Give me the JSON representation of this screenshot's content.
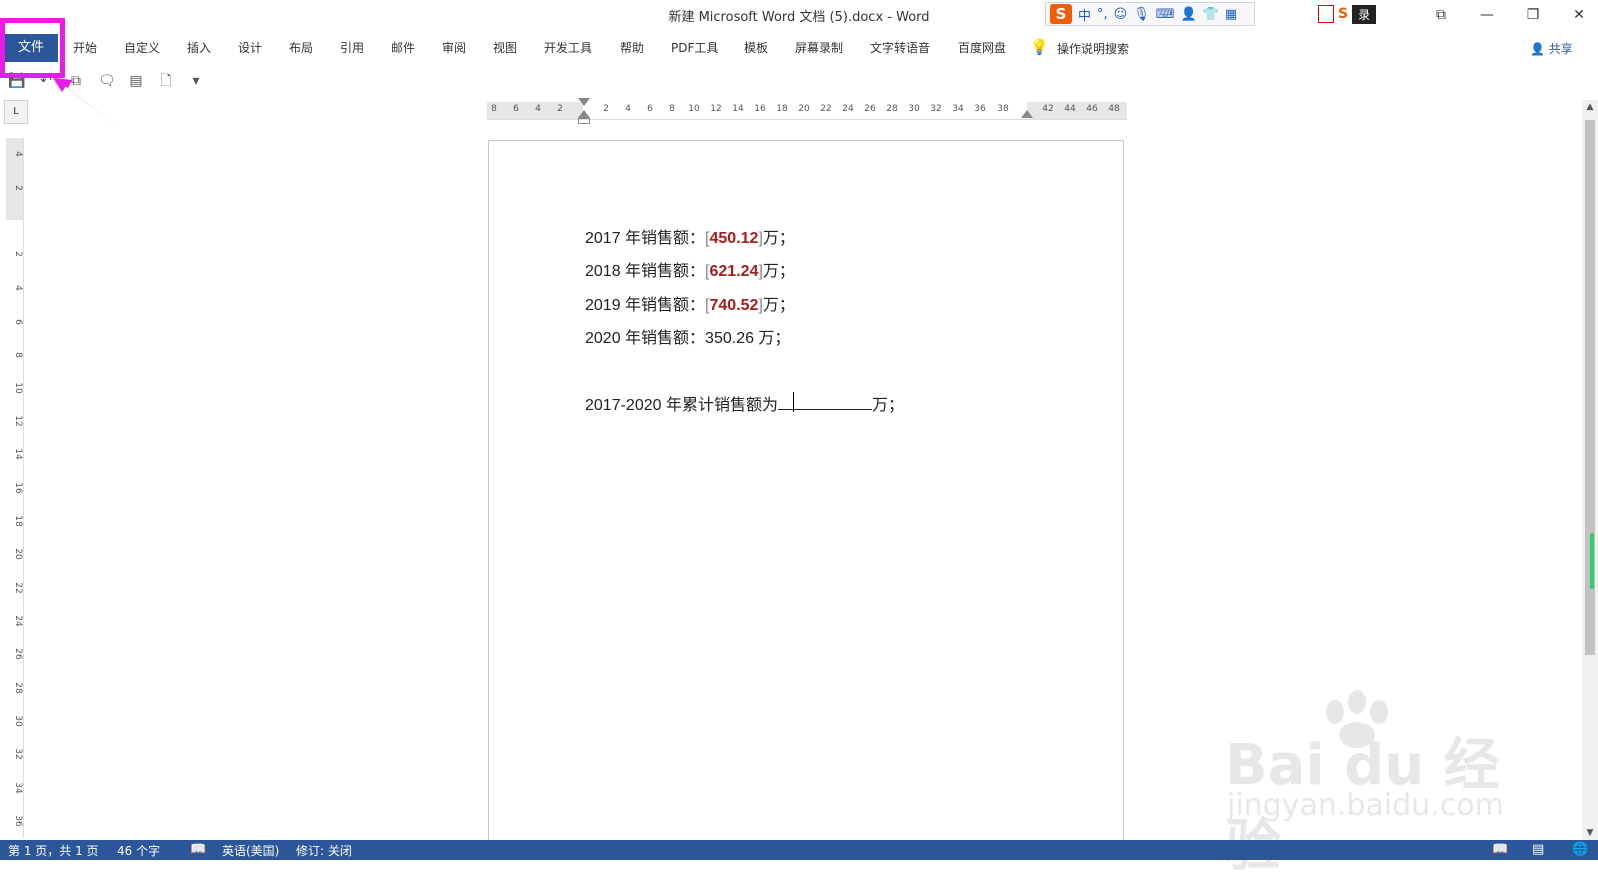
{
  "titlebar": {
    "title": "新建 Microsoft Word 文档 (5).docx  -  Word",
    "ime_label": "中",
    "acct_text": "录",
    "win_buttons": {
      "ribbon_opts": "⧉",
      "minimize": "—",
      "restore": "❐",
      "close": "✕"
    }
  },
  "ribbon": {
    "tabs": [
      "文件",
      "开始",
      "自定义",
      "插入",
      "设计",
      "布局",
      "引用",
      "邮件",
      "审阅",
      "视图",
      "开发工具",
      "帮助",
      "PDF工具",
      "模板",
      "屏幕录制",
      "文字转语音",
      "百度网盘"
    ],
    "tell_me": "操作说明搜索",
    "share": "共享"
  },
  "ruler": {
    "horizontal": [
      "8",
      "6",
      "4",
      "2",
      "2",
      "4",
      "6",
      "8",
      "10",
      "12",
      "14",
      "16",
      "18",
      "20",
      "22",
      "24",
      "26",
      "28",
      "30",
      "32",
      "34",
      "36",
      "38",
      "42",
      "44",
      "46",
      "48"
    ],
    "vertical": [
      "4",
      "2",
      "2",
      "4",
      "6",
      "8",
      "10",
      "12",
      "14",
      "16",
      "18",
      "20",
      "22",
      "24",
      "26",
      "28",
      "30",
      "32",
      "34",
      "36"
    ],
    "tab_selector": "L"
  },
  "document": {
    "lines": [
      {
        "prefix": "2017 年销售额：",
        "value": "450.12",
        "suffix": "万；"
      },
      {
        "prefix": "2018 年销售额：",
        "value": "621.24",
        "suffix": "万；"
      },
      {
        "prefix": "2019 年销售额：",
        "value": "740.52",
        "suffix": "万；"
      },
      {
        "prefix": "2020 年销售额：",
        "value": "350.26 万；",
        "suffix": ""
      }
    ],
    "total_prefix": "2017-2020 年累计销售额为",
    "total_suffix": "万；"
  },
  "statusbar": {
    "page": "第 1 页，共 1 页",
    "words": "46 个字",
    "language": "英语(美国)",
    "track": "修订: 关闭"
  },
  "watermark": {
    "logo": "Bai du 经验",
    "url": "jingyan.baidu.com"
  },
  "colors": {
    "accent": "#2b579a",
    "highlight": "#e71ce7",
    "field_value": "#a51d1d"
  }
}
